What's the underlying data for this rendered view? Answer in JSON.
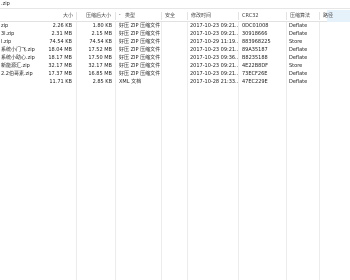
{
  "path": {
    "text": ".zip"
  },
  "columns": {
    "size": "大小",
    "packed": "压缩后大小",
    "type": "类型",
    "security": "安全",
    "modified": "修改时间",
    "crc": "CRC32",
    "method": "压缩算法",
    "path": "路径"
  },
  "rows": [
    {
      "name": "zip",
      "size": "2.26 KB",
      "packed": "1.80 KB",
      "type": "好压 ZIP 压缩文件",
      "modified": "2017-10-23 09:21...",
      "crc": "0DC01008",
      "method": "Deflate"
    },
    {
      "name": "3l.zip",
      "size": "2.31 MB",
      "packed": "2.15 MB",
      "type": "好压 ZIP 压缩文件",
      "modified": "2017-10-23 09:21...",
      "crc": "30918666",
      "method": "Deflate"
    },
    {
      "name": "l.zip",
      "size": "74.54 KB",
      "packed": "74.54 KB",
      "type": "好压 ZIP 压缩文件",
      "modified": "2017-10-29 11:19...",
      "crc": "883968225",
      "method": "Store"
    },
    {
      "name": "系统小门飞.zip",
      "size": "18.04 MB",
      "packed": "17.52 MB",
      "type": "好压 ZIP 压缩文件",
      "modified": "2017-10-23 09:21...",
      "crc": "89A35187",
      "method": "Deflate"
    },
    {
      "name": "系统小助心.zip",
      "size": "18.17 MB",
      "packed": "17.50 MB",
      "type": "好压 ZIP 压缩文件",
      "modified": "2017-10-23 09:36...",
      "crc": "B8235188",
      "method": "Deflate"
    },
    {
      "name": "新能源汇.zip",
      "size": "32.17 MB",
      "packed": "32.17 MB",
      "type": "好压 ZIP 压缩文件",
      "modified": "2017-10-23 09:21...",
      "crc": "4E22B8DF",
      "method": "Store"
    },
    {
      "name": "2.2伯哥素.zip",
      "size": "17.37 MB",
      "packed": "16.85 MB",
      "type": "好压 ZIP 压缩文件",
      "modified": "2017-10-23 09:21...",
      "crc": "73ECF26E",
      "method": "Deflate"
    },
    {
      "name": "",
      "size": "11.71 KB",
      "packed": "2.85 KB",
      "type": "XML 文档",
      "modified": "2017-10-28 21:33...",
      "crc": "47EC229E",
      "method": "Deflate"
    }
  ]
}
